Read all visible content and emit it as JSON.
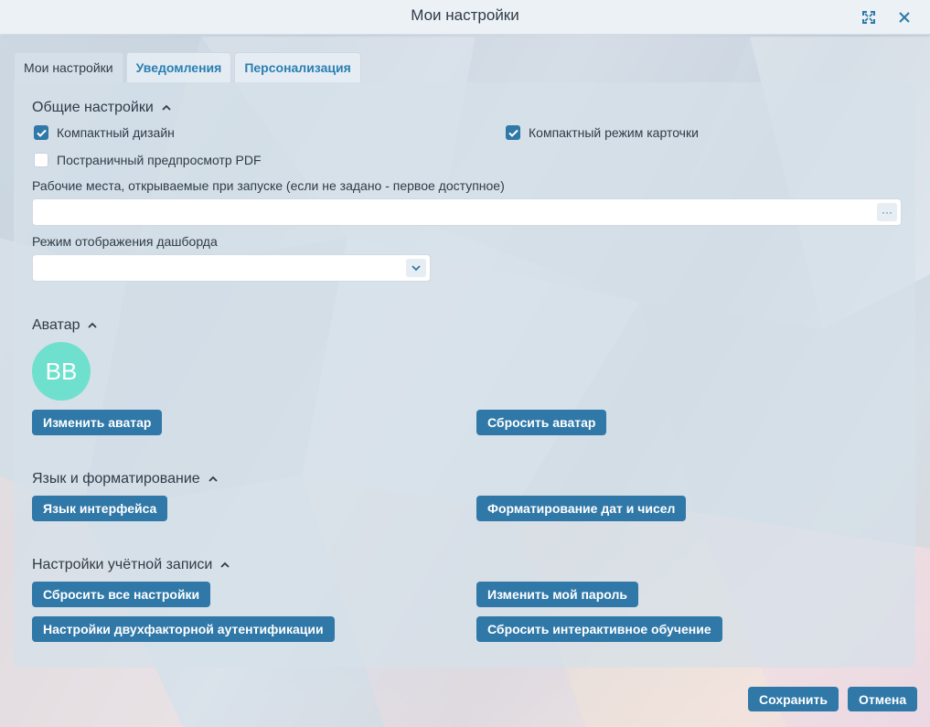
{
  "window": {
    "title": "Мои настройки",
    "expand_icon": "expand-icon",
    "close_icon": "close-icon"
  },
  "tabs": [
    {
      "label": "Мои настройки",
      "active": true
    },
    {
      "label": "Уведомления",
      "active": false
    },
    {
      "label": "Персонализация",
      "active": false
    }
  ],
  "general": {
    "title": "Общие настройки",
    "compact_design": {
      "label": "Компактный дизайн",
      "checked": true
    },
    "compact_card": {
      "label": "Компактный режим карточки",
      "checked": true
    },
    "pdf_preview": {
      "label": "Постраничный предпросмотр PDF",
      "checked": false
    },
    "workplaces_label": "Рабочие места, открываемые при запуске (если не задано - первое доступное)",
    "workplaces_value": "",
    "workplaces_button": "···",
    "dashboard_label": "Режим отображения дашборда",
    "dashboard_value": ""
  },
  "avatar": {
    "title": "Аватар",
    "initials": "BB",
    "color": "#6fe0cd",
    "change_label": "Изменить аватар",
    "reset_label": "Сбросить аватар"
  },
  "language": {
    "title": "Язык и форматирование",
    "interface_language_label": "Язык интерфейса",
    "formatting_label": "Форматирование дат и чисел"
  },
  "account": {
    "title": "Настройки учётной записи",
    "reset_all_label": "Сбросить все настройки",
    "change_password_label": "Изменить мой пароль",
    "two_factor_label": "Настройки двухфакторной аутентификации",
    "reset_tutorial_label": "Сбросить интерактивное обучение"
  },
  "footer": {
    "save_label": "Сохранить",
    "cancel_label": "Отмена"
  },
  "colors": {
    "accent": "#2f78a8",
    "tab_text": "#2a7fb2",
    "avatar_bg": "#6fe0cd"
  }
}
